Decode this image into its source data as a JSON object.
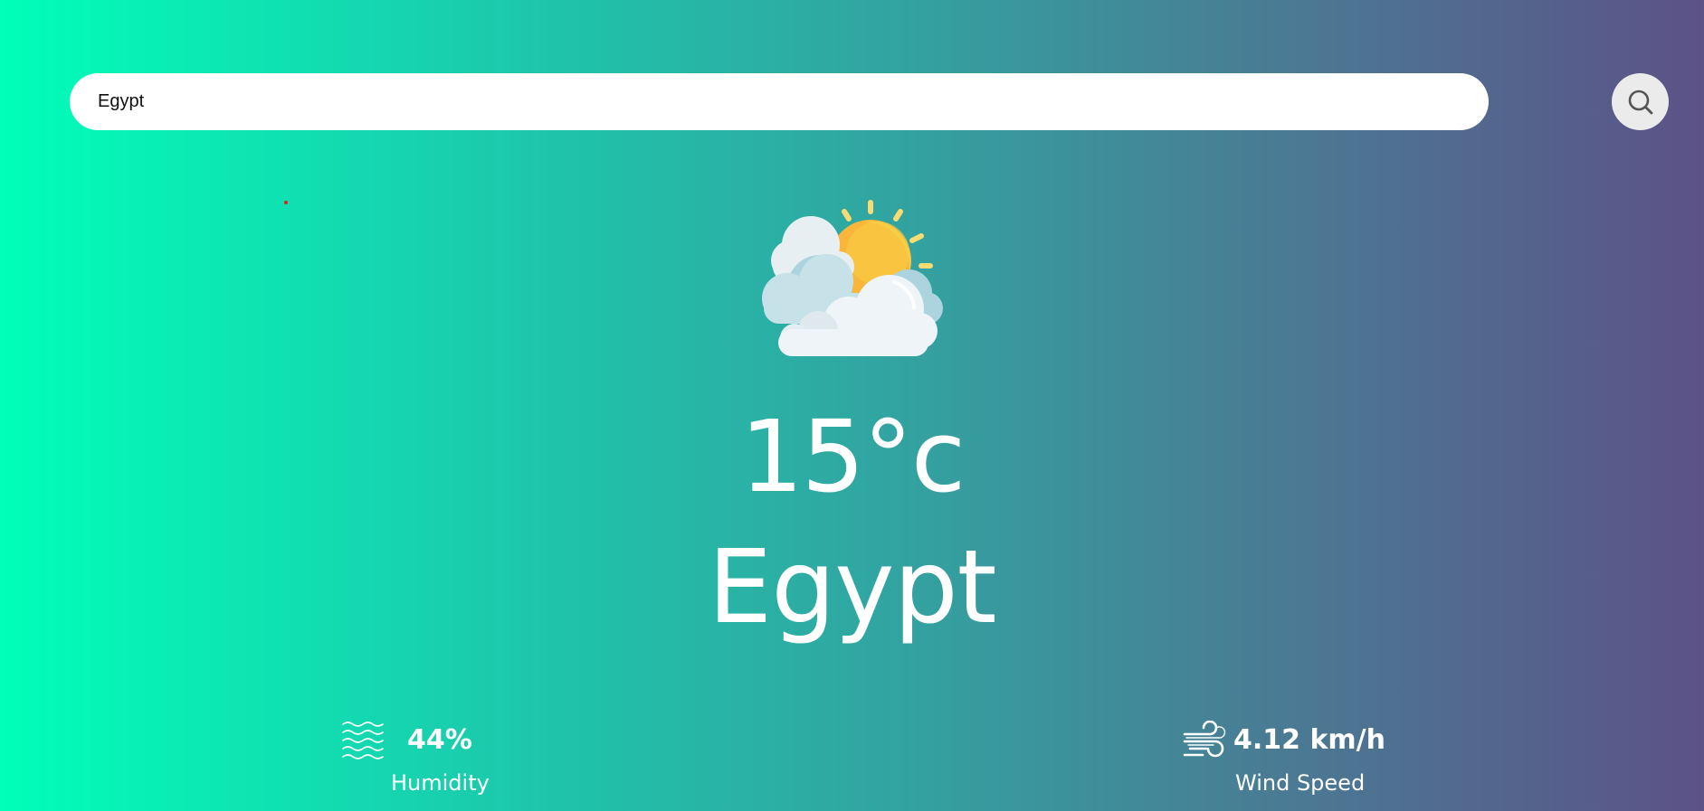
{
  "search": {
    "value": "Egypt",
    "icon": "search-icon"
  },
  "weather": {
    "icon": "partly-cloudy-icon",
    "temperature": "15°c",
    "city": "Egypt"
  },
  "humidity": {
    "icon": "humidity-waves-icon",
    "value": "44%",
    "label": "Humidity"
  },
  "wind": {
    "icon": "wind-icon",
    "value": "4.12 km/h",
    "label": "Wind Speed"
  },
  "colors": {
    "gradient_start": "#00ffb9",
    "gradient_end": "#5c5287",
    "text": "#ffffff",
    "sun": "#f8b93a",
    "cloud": "#eef4f7"
  }
}
